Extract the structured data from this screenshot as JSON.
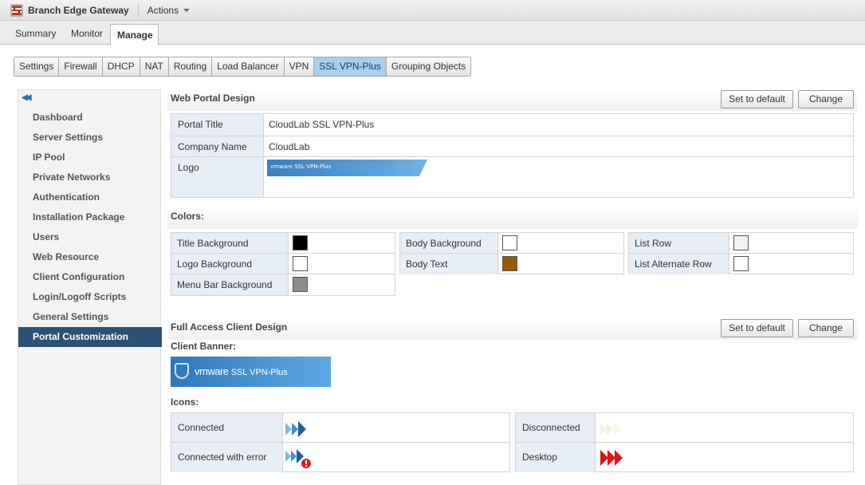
{
  "header": {
    "app_title": "Branch Edge Gateway",
    "actions_label": "Actions"
  },
  "main_tabs": [
    "Summary",
    "Monitor",
    "Manage"
  ],
  "sub_tabs": [
    "Settings",
    "Firewall",
    "DHCP",
    "NAT",
    "Routing",
    "Load Balancer",
    "VPN",
    "SSL VPN-Plus",
    "Grouping Objects"
  ],
  "nav": {
    "collapse_icon": "double-chevron-left-icon",
    "items": [
      "Dashboard",
      "Server Settings",
      "IP Pool",
      "Private Networks",
      "Authentication",
      "Installation Package",
      "Users",
      "Web Resource",
      "Client Configuration",
      "Login/Logoff Scripts",
      "General Settings",
      "Portal Customization"
    ]
  },
  "web_portal": {
    "title": "Web Portal Design",
    "set_default_label": "Set to default",
    "change_label": "Change",
    "portal_title_label": "Portal Title",
    "portal_title_value": "CloudLab SSL VPN-Plus",
    "company_name_label": "Company Name",
    "company_name_value": "CloudLab",
    "logo_label": "Logo",
    "logo_text": "vmware SSL VPN-Plus"
  },
  "colors": {
    "title": "Colors:",
    "items": [
      {
        "label": "Title Background",
        "color": "#000000"
      },
      {
        "label": "Logo Background",
        "color": "#ffffff"
      },
      {
        "label": "Menu Bar Background",
        "color": "#8c8c8c"
      },
      {
        "label": "Body Background",
        "color": "#ffffff"
      },
      {
        "label": "Body Text",
        "color": "#9a5a00"
      },
      {
        "label": "List Row",
        "color": "#f2f2f2"
      },
      {
        "label": "List Alternate Row",
        "color": "#ffffff"
      }
    ]
  },
  "client_design": {
    "title": "Full Access Client Design",
    "set_default_label": "Set to default",
    "change_label": "Change",
    "banner_label": "Client Banner:",
    "banner_brand": "vmware",
    "banner_text": "SSL VPN-Plus",
    "icons_label": "Icons:",
    "icons": [
      {
        "label": "Connected",
        "icon": "connected-icon"
      },
      {
        "label": "Connected with error",
        "icon": "connected-error-icon"
      },
      {
        "label": "Disconnected",
        "icon": "disconnected-icon"
      },
      {
        "label": "Desktop",
        "icon": "desktop-icon"
      }
    ]
  }
}
